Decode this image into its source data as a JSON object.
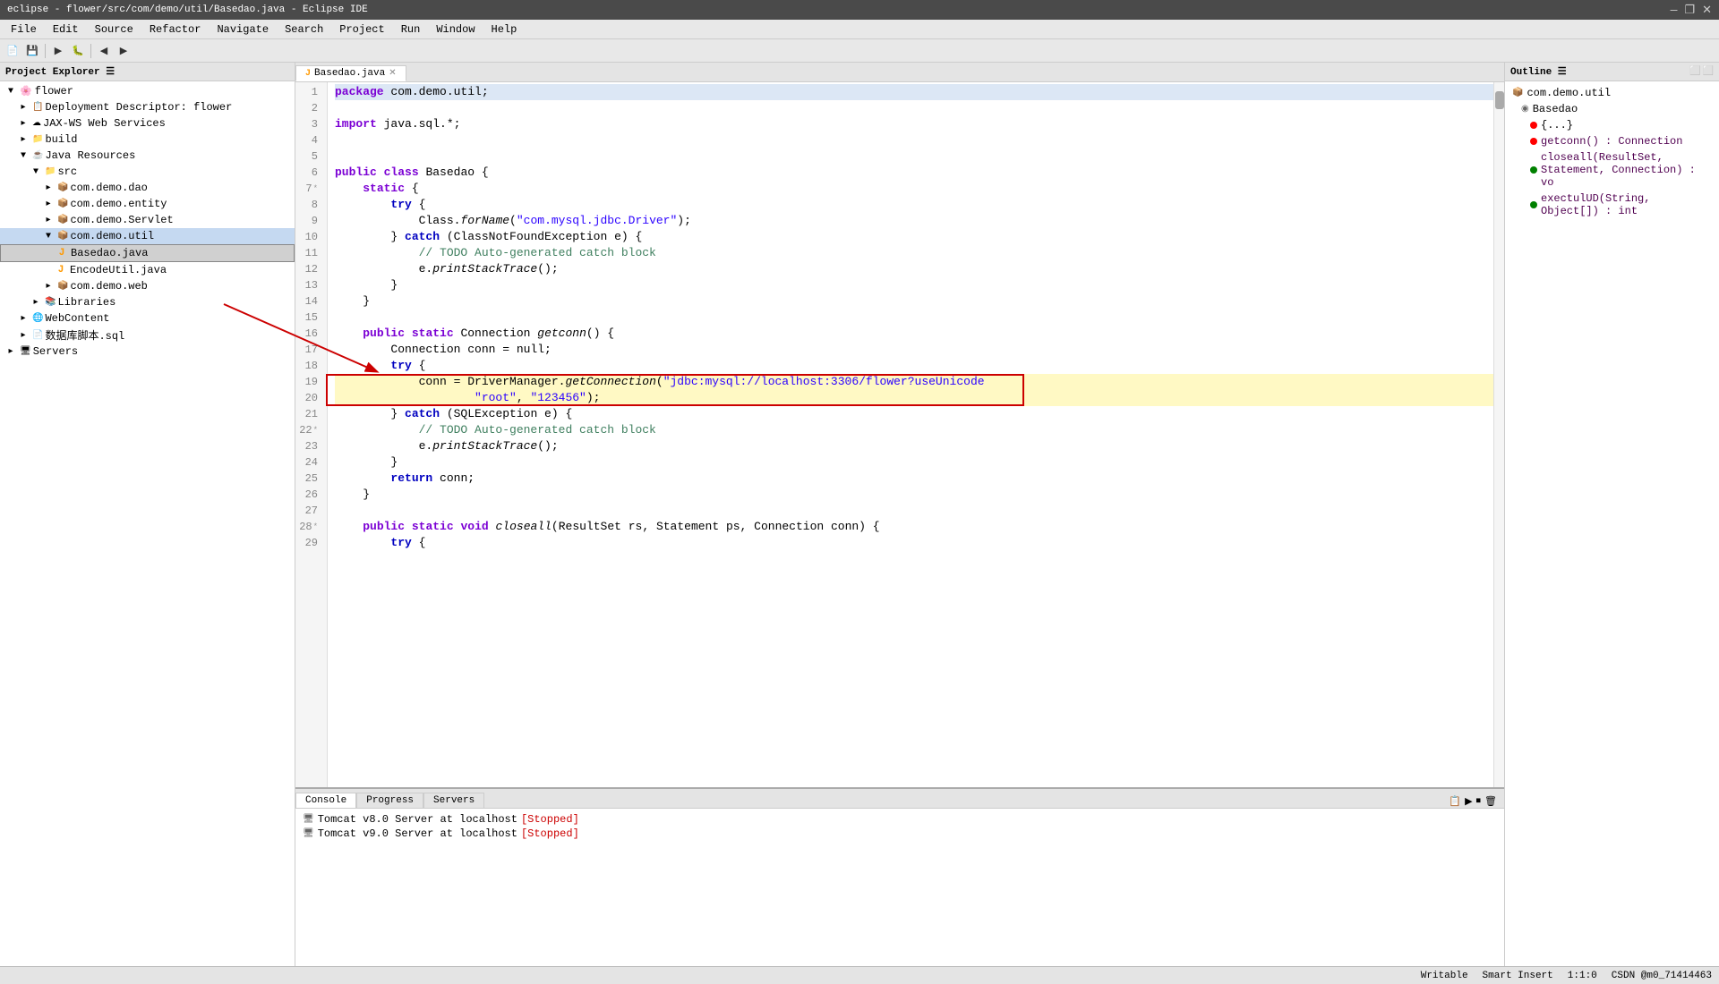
{
  "titlebar": {
    "title": "eclipse - flower/src/com/demo/util/Basedao.java - Eclipse IDE",
    "controls": [
      "—",
      "❐",
      "✕"
    ]
  },
  "menubar": {
    "items": [
      "File",
      "Edit",
      "Source",
      "Refactor",
      "Navigate",
      "Search",
      "Project",
      "Run",
      "Window",
      "Help"
    ]
  },
  "project_explorer": {
    "header": "Project Explorer ☰",
    "tree": [
      {
        "level": 1,
        "label": "flower",
        "icon": "▸",
        "type": "project"
      },
      {
        "level": 2,
        "label": "Deployment Descriptor: flower",
        "icon": "📋",
        "type": "descriptor"
      },
      {
        "level": 2,
        "label": "JAX-WS Web Services",
        "icon": "☁",
        "type": "service"
      },
      {
        "level": 2,
        "label": "build",
        "icon": "📁",
        "type": "folder"
      },
      {
        "level": 2,
        "label": "Java Resources",
        "icon": "☕",
        "type": "java-resources",
        "expanded": true
      },
      {
        "level": 3,
        "label": "src",
        "icon": "📁",
        "type": "folder",
        "expanded": true
      },
      {
        "level": 4,
        "label": "com.demo.dao",
        "icon": "📦",
        "type": "package"
      },
      {
        "level": 4,
        "label": "com.demo.entity",
        "icon": "📦",
        "type": "package"
      },
      {
        "level": 4,
        "label": "com.demo.Servlet",
        "icon": "📦",
        "type": "package"
      },
      {
        "level": 4,
        "label": "com.demo.util",
        "icon": "📦",
        "type": "package",
        "expanded": true,
        "selected": true
      },
      {
        "level": 5,
        "label": "Basedao.java",
        "icon": "J",
        "type": "java-file",
        "highlighted": true
      },
      {
        "level": 5,
        "label": "EncodeUtil.java",
        "icon": "J",
        "type": "java-file"
      },
      {
        "level": 4,
        "label": "com.demo.web",
        "icon": "📦",
        "type": "package"
      },
      {
        "level": 3,
        "label": "Libraries",
        "icon": "📚",
        "type": "libraries"
      },
      {
        "level": 2,
        "label": "WebContent",
        "icon": "🌐",
        "type": "webcontent"
      },
      {
        "level": 2,
        "label": "数据库脚本.sql",
        "icon": "📄",
        "type": "sql-file"
      },
      {
        "level": 1,
        "label": "Servers",
        "icon": "▸",
        "type": "servers"
      }
    ]
  },
  "editor": {
    "tab_title": "Basedao.java",
    "lines": [
      {
        "num": 1,
        "tokens": [
          {
            "t": "kw",
            "v": "package"
          },
          {
            "t": "normal",
            "v": " com.demo.util;"
          }
        ]
      },
      {
        "num": 2,
        "tokens": []
      },
      {
        "num": 3,
        "tokens": [
          {
            "t": "kw",
            "v": "import"
          },
          {
            "t": "normal",
            "v": " java.sql.*;"
          }
        ]
      },
      {
        "num": 4,
        "tokens": []
      },
      {
        "num": 5,
        "tokens": []
      },
      {
        "num": 6,
        "tokens": [
          {
            "t": "kw",
            "v": "public"
          },
          {
            "t": "normal",
            "v": " "
          },
          {
            "t": "kw",
            "v": "class"
          },
          {
            "t": "normal",
            "v": " Basedao {"
          }
        ]
      },
      {
        "num": 7,
        "tokens": [
          {
            "t": "normal",
            "v": "    "
          },
          {
            "t": "kw",
            "v": "static"
          },
          {
            "t": "normal",
            "v": " {"
          }
        ]
      },
      {
        "num": 8,
        "tokens": [
          {
            "t": "normal",
            "v": "        "
          },
          {
            "t": "kw2",
            "v": "try"
          },
          {
            "t": "normal",
            "v": " {"
          }
        ]
      },
      {
        "num": 9,
        "tokens": [
          {
            "t": "normal",
            "v": "            Class."
          },
          {
            "t": "method",
            "v": "forName"
          },
          {
            "t": "normal",
            "v": "("
          },
          {
            "t": "str",
            "v": "\"com.mysql.jdbc.Driver\""
          },
          {
            "t": "normal",
            "v": ");"
          }
        ]
      },
      {
        "num": 10,
        "tokens": [
          {
            "t": "normal",
            "v": "        } "
          },
          {
            "t": "kw2",
            "v": "catch"
          },
          {
            "t": "normal",
            "v": " (ClassNotFoundException e) {"
          }
        ]
      },
      {
        "num": 11,
        "tokens": [
          {
            "t": "comment-text",
            "v": "            // TODO Auto-generated catch block"
          }
        ],
        "is_comment": true
      },
      {
        "num": 12,
        "tokens": [
          {
            "t": "normal",
            "v": "            e."
          },
          {
            "t": "method",
            "v": "printStackTrace"
          },
          {
            "t": "normal",
            "v": "();"
          }
        ]
      },
      {
        "num": 13,
        "tokens": [
          {
            "t": "normal",
            "v": "        }"
          }
        ]
      },
      {
        "num": 14,
        "tokens": [
          {
            "t": "normal",
            "v": "    }"
          }
        ]
      },
      {
        "num": 15,
        "tokens": []
      },
      {
        "num": 16,
        "tokens": [
          {
            "t": "normal",
            "v": "    "
          },
          {
            "t": "kw",
            "v": "public"
          },
          {
            "t": "normal",
            "v": " "
          },
          {
            "t": "kw",
            "v": "static"
          },
          {
            "t": "normal",
            "v": " Connection "
          },
          {
            "t": "method",
            "v": "getconn"
          },
          {
            "t": "normal",
            "v": "() {"
          }
        ]
      },
      {
        "num": 17,
        "tokens": [
          {
            "t": "normal",
            "v": "        Connection conn = null;"
          }
        ]
      },
      {
        "num": 18,
        "tokens": [
          {
            "t": "normal",
            "v": "        "
          },
          {
            "t": "kw2",
            "v": "try"
          },
          {
            "t": "normal",
            "v": " {"
          }
        ],
        "is_highlighted": true
      },
      {
        "num": 19,
        "tokens": [
          {
            "t": "normal",
            "v": "            conn = DriverManager."
          },
          {
            "t": "method",
            "v": "getConnection"
          },
          {
            "t": "normal",
            "v": "("
          },
          {
            "t": "str",
            "v": "\"jdbc:mysql://localhost:3306/flower?useUnicode"
          }
        ]
      },
      {
        "num": 20,
        "tokens": [
          {
            "t": "normal",
            "v": "                    "
          },
          {
            "t": "str",
            "v": "\"root\""
          },
          {
            "t": "normal",
            "v": ", "
          },
          {
            "t": "str",
            "v": "\"123456\""
          },
          {
            "t": "normal",
            "v": ");"
          }
        ]
      },
      {
        "num": 21,
        "tokens": [
          {
            "t": "normal",
            "v": "        } "
          },
          {
            "t": "kw2",
            "v": "catch"
          },
          {
            "t": "normal",
            "v": " (SQLException e) {"
          }
        ]
      },
      {
        "num": 22,
        "tokens": [
          {
            "t": "comment-text",
            "v": "            // TODO Auto-generated catch block"
          }
        ],
        "is_comment": true
      },
      {
        "num": 23,
        "tokens": [
          {
            "t": "normal",
            "v": "            e."
          },
          {
            "t": "method",
            "v": "printStackTrace"
          },
          {
            "t": "normal",
            "v": "();"
          }
        ]
      },
      {
        "num": 24,
        "tokens": [
          {
            "t": "normal",
            "v": "        }"
          }
        ]
      },
      {
        "num": 25,
        "tokens": [
          {
            "t": "normal",
            "v": "        "
          },
          {
            "t": "kw2",
            "v": "return"
          },
          {
            "t": "normal",
            "v": " conn;"
          }
        ]
      },
      {
        "num": 26,
        "tokens": [
          {
            "t": "normal",
            "v": "    }"
          }
        ]
      },
      {
        "num": 27,
        "tokens": []
      },
      {
        "num": 28,
        "tokens": [
          {
            "t": "normal",
            "v": "    "
          },
          {
            "t": "kw",
            "v": "public"
          },
          {
            "t": "normal",
            "v": " "
          },
          {
            "t": "kw",
            "v": "static"
          },
          {
            "t": "normal",
            "v": " "
          },
          {
            "t": "kw",
            "v": "void"
          },
          {
            "t": "normal",
            "v": " "
          },
          {
            "t": "method",
            "v": "closeall"
          },
          {
            "t": "normal",
            "v": "(ResultSet rs, Statement ps, Connection conn) {"
          }
        ]
      },
      {
        "num": 29,
        "tokens": [
          {
            "t": "normal",
            "v": "        "
          },
          {
            "t": "kw2",
            "v": "try"
          },
          {
            "t": "normal",
            "v": " {"
          }
        ]
      }
    ]
  },
  "outline": {
    "header": "Outline ☰",
    "items": [
      {
        "label": "com.demo.util",
        "icon": "package",
        "level": 1
      },
      {
        "label": "Basedao",
        "icon": "class",
        "level": 2
      },
      {
        "label": "{...}",
        "icon": "block",
        "level": 3,
        "color": "red"
      },
      {
        "label": "getconn() : Connection",
        "icon": "method",
        "level": 3,
        "color": "red"
      },
      {
        "label": "closeall(ResultSet, Statement, Connection) : vo",
        "icon": "method",
        "level": 3,
        "color": "green"
      },
      {
        "label": "exectulUD(String, Object[]) : int",
        "icon": "method",
        "level": 3,
        "color": "green"
      }
    ]
  },
  "bottom_panel": {
    "tabs": [
      "Console",
      "Progress",
      "Servers"
    ],
    "active_tab": "Console",
    "console_items": [
      {
        "label": "Tomcat v8.0 Server at localhost",
        "status": "[Stopped]"
      },
      {
        "label": "Tomcat v9.0 Server at localhost",
        "status": "[Stopped]"
      }
    ]
  },
  "statusbar": {
    "writable": "Writable",
    "insert_mode": "Smart Insert",
    "position": "1:1:0",
    "credits": "CSDN @m0_71414463"
  }
}
